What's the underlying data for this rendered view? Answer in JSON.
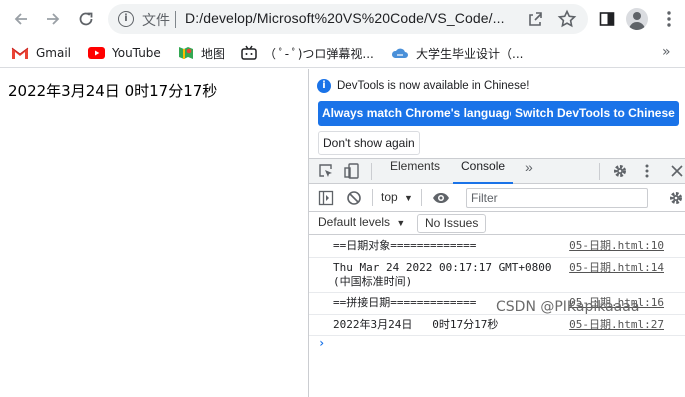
{
  "toolbar": {
    "address_label": "文件",
    "url": "D:/develop/Microsoft%20VS%20Code/VS_Code/..."
  },
  "bookmarks": {
    "items": [
      {
        "label": "Gmail",
        "icon": "gmail-icon"
      },
      {
        "label": "YouTube",
        "icon": "youtube-icon"
      },
      {
        "label": "地图",
        "icon": "maps-icon"
      },
      {
        "label": "（ ﾟ- ﾟ)つロ弹幕视...",
        "icon": "bilibili-icon"
      },
      {
        "label": "大学生毕业设计（...",
        "icon": "cloud-icon"
      }
    ],
    "more": "»"
  },
  "page": {
    "text": "2022年3月24日 0时17分17秒"
  },
  "devtools": {
    "infobar": {
      "message": "DevTools is now available in Chinese!",
      "always_match": "Always match Chrome's language",
      "switch_chinese": "Switch DevTools to Chinese",
      "dont_show": "Don't show again"
    },
    "tabs": {
      "elements": "Elements",
      "console": "Console",
      "more": "»"
    },
    "console_bar": {
      "context": "top",
      "filter_placeholder": "Filter"
    },
    "levels": {
      "default_levels": "Default levels",
      "no_issues": "No Issues"
    },
    "logs": [
      {
        "message": "==日期对象=============",
        "source": "05-日期.html:10"
      },
      {
        "message": "Thu Mar 24 2022 00:17:17 GMT+0800\n(中国标准时间)",
        "source": "05-日期.html:14"
      },
      {
        "message": "==拼接日期=============",
        "source": "05-日期.html:16"
      },
      {
        "message": "2022年3月24日   0时17分17秒",
        "source": "05-日期.html:27"
      }
    ],
    "prompt": "›"
  },
  "watermark": "CSDN @PIKapikaaaa",
  "colors": {
    "accent": "#1a73e8",
    "toolbar_bg": "#f1f3f4"
  }
}
